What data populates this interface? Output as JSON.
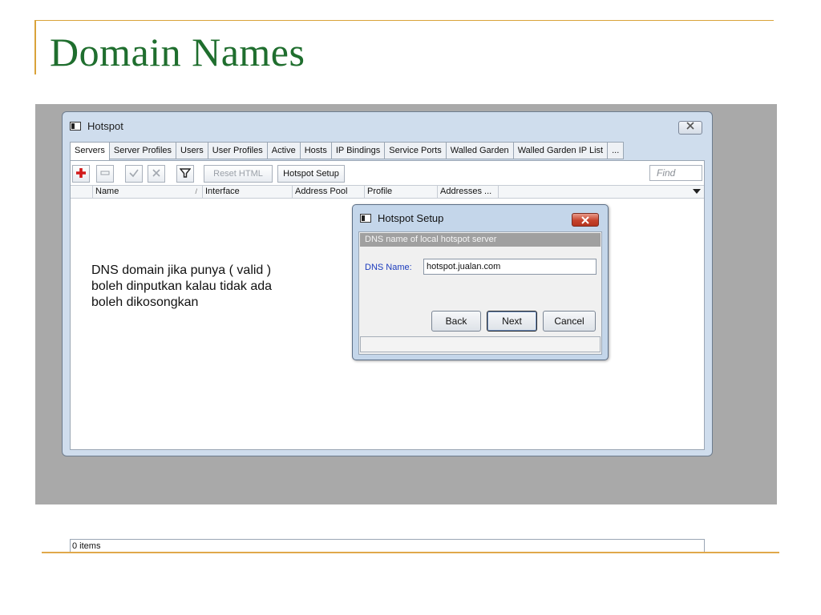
{
  "slide": {
    "title": "Domain Names",
    "note_lines": [
      "DNS domain jika punya ( valid )",
      "boleh dinputkan kalau tidak ada",
      "boleh dikosongkan"
    ]
  },
  "window": {
    "title": "Hotspot",
    "close_icon": "close-icon",
    "tabs": [
      {
        "label": "Servers",
        "active": true
      },
      {
        "label": "Server Profiles"
      },
      {
        "label": "Users"
      },
      {
        "label": "User Profiles"
      },
      {
        "label": "Active"
      },
      {
        "label": "Hosts"
      },
      {
        "label": "IP Bindings"
      },
      {
        "label": "Service Ports"
      },
      {
        "label": "Walled Garden"
      },
      {
        "label": "Walled Garden IP List"
      },
      {
        "label": "..."
      }
    ],
    "toolbar": {
      "add_icon": "plus-icon",
      "remove_icon": "minus-icon",
      "enable_icon": "check-icon",
      "disable_icon": "cross-icon",
      "filter_icon": "filter-icon",
      "reset_html_label": "Reset HTML",
      "hotspot_setup_label": "Hotspot Setup",
      "find_placeholder": "Find"
    },
    "columns": [
      "Name",
      "Interface",
      "Address Pool",
      "Profile",
      "Addresses ..."
    ],
    "sort_indicator": "/",
    "status": "0 items"
  },
  "dialog": {
    "title": "Hotspot Setup",
    "header": "DNS name of local hotspot server",
    "dns_label": "DNS Name:",
    "dns_value": "hotspot.jualan.com",
    "buttons": {
      "back": "Back",
      "next": "Next",
      "cancel": "Cancel"
    }
  },
  "colors": {
    "title_green": "#1f6e2e",
    "rule_gold": "#d9a33a",
    "dialog_close_red": "#c6432c",
    "dns_label_blue": "#1b3bbd"
  }
}
